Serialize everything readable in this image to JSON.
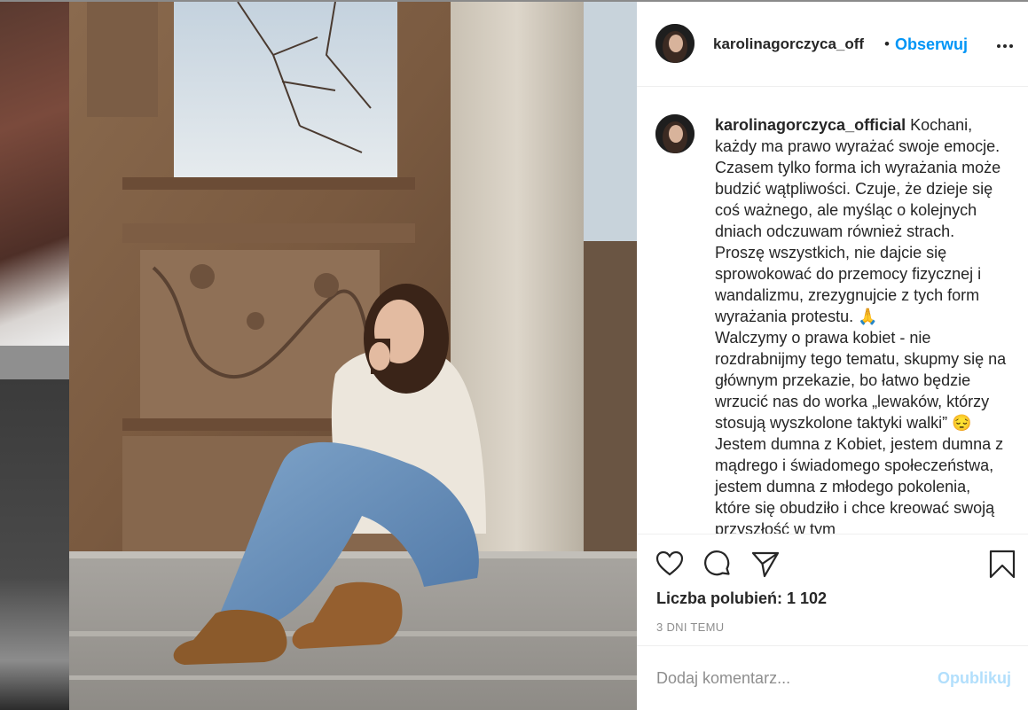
{
  "post": {
    "author": "karolinagorczyca_off",
    "separator": "•",
    "follow_label": "Obserwuj",
    "more_icon": "more-options-icon",
    "image_subject": "woman-sitting-on-steps-photo"
  },
  "caption": {
    "username": "karolinagorczyca_official",
    "text": " Kochani, każdy ma prawo wyrażać swoje emocje. Czasem tylko forma ich wyrażania może budzić wątpliwości. Czuje, że dzieje się coś ważnego, ale myśląc o kolejnych dniach odczuwam również strach. Proszę wszystkich, nie dajcie się sprowokować do przemocy fizycznej i wandalizmu, zrezygnujcie z tych form wyrażania protestu. 🙏\nWalczymy o prawa kobiet - nie rozdrabnijmy tego tematu, skupmy się na głównym przekazie, bo łatwo będzie wrzucić nas do worka „lewaków, którzy stosują wyszkolone taktyki walki” 😔\nJestem dumna z Kobiet, jestem dumna z mądrego i świadomego społeczeństwa, jestem dumna z młodego pokolenia, które się obudziło i chce kreować swoją przyszłość w tym"
  },
  "actions": {
    "like_icon": "heart-icon",
    "comment_icon": "comment-bubble-icon",
    "share_icon": "paper-plane-icon",
    "save_icon": "bookmark-icon"
  },
  "likes_text": "Liczba polubień: 1 102",
  "date_text": "3 DNI TEMU",
  "comment_box": {
    "placeholder": "Dodaj komentarz...",
    "publish_label": "Opublikuj"
  },
  "colors": {
    "accent": "#0095f6",
    "publish_disabled": "#b2dffc",
    "text": "#262626",
    "muted": "#8e8e8e"
  }
}
